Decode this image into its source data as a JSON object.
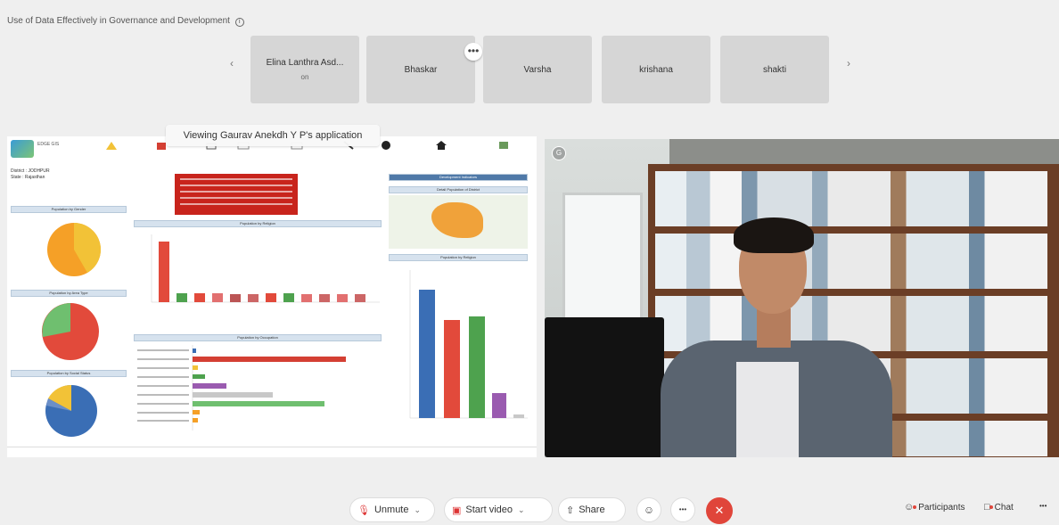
{
  "meeting": {
    "title": "Use of Data Effectively in Governance and Development",
    "info_icon": "i"
  },
  "participants": {
    "prev_arrow": "‹",
    "next_arrow": "›",
    "tiles": [
      {
        "name": "Elina Lanthra Asd...",
        "sub": "on"
      },
      {
        "name": "Bhaskar",
        "sub": ""
      },
      {
        "name": "Varsha",
        "sub": ""
      },
      {
        "name": "krishana",
        "sub": ""
      },
      {
        "name": "shakti",
        "sub": ""
      }
    ],
    "more_label": "•••"
  },
  "share": {
    "viewing_banner": "Viewing Gaurav Anekdh Y P's application"
  },
  "dashboard": {
    "logo_text": "EDGE GIS",
    "meta_lines": [
      "District : JODHPUR",
      "State : Rajasthan"
    ],
    "nav_items": [
      "WEALTHIE",
      "HEALTH",
      "LABOR",
      "GOVERNANCE",
      "TRADE",
      "SECURITY",
      "GOVERNANCE",
      "HOME",
      "INFRA"
    ],
    "panels": {
      "population_left_1": "Population by Gender",
      "population_left_2": "Population by Area Type",
      "population_left_3": "Population by Social Status",
      "pop_religion": "Population by Religion",
      "pop_occupation": "Population by Occupation",
      "dev_indicators": "Development Indicators",
      "district_map_title": "Detail Population of District",
      "pop_religion_right": "Population by Religion",
      "map_label": "Jodhpur"
    }
  },
  "video": {
    "badge": "G"
  },
  "controls": {
    "unmute": "Unmute",
    "start_video": "Start video",
    "share": "Share",
    "reactions_icon": "☺",
    "more": "•••",
    "end_icon": "✕",
    "participants": "Participants",
    "chat": "Chat",
    "more_right": "•••"
  },
  "colors": {
    "end_call": "#e0453a",
    "chart_red": "#e24a3b",
    "chart_green": "#4ea24e",
    "chart_blue": "#3a6eb5",
    "chart_orange": "#f5a027",
    "chart_purple": "#9a5bb0",
    "chart_yellow": "#f2c237"
  }
}
